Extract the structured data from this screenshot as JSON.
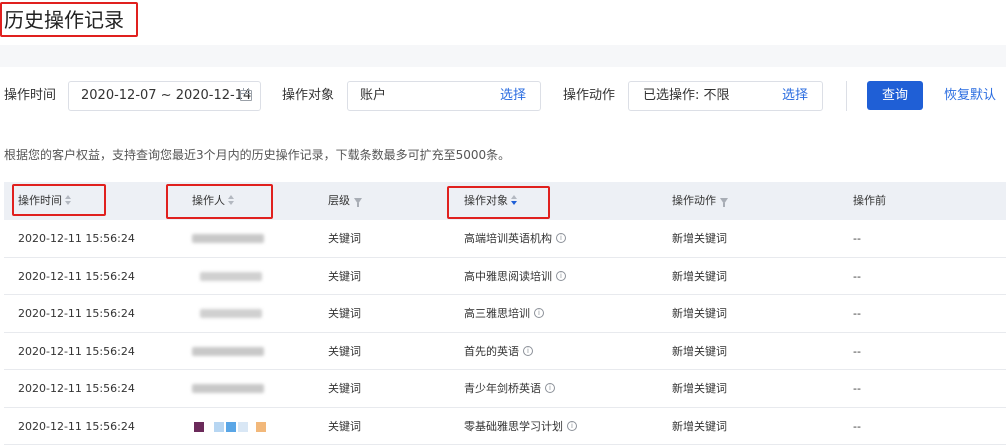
{
  "page_title": "历史操作记录",
  "filters": {
    "time_label": "操作时间",
    "time_value": "2020-12-07 ~ 2020-12-14",
    "object_label": "操作对象",
    "object_value": "账户",
    "object_select": "选择",
    "action_label": "操作动作",
    "action_value": "已选操作: 不限",
    "action_select": "选择",
    "query_button": "查询",
    "reset_link": "恢复默认"
  },
  "notice": "根据您的客户权益，支持查询您最近3个月内的历史操作记录，下载条数最多可扩充至5000条。",
  "table": {
    "headers": [
      "操作时间",
      "操作人",
      "层级",
      "操作对象",
      "操作动作",
      "操作前"
    ],
    "rows": [
      {
        "time": "2020-12-11 15:56:24",
        "level": "关键词",
        "object": "高端培训英语机构",
        "action": "新增关键词",
        "before": "--"
      },
      {
        "time": "2020-12-11 15:56:24",
        "level": "关键词",
        "object": "高中雅思阅读培训",
        "action": "新增关键词",
        "before": "--"
      },
      {
        "time": "2020-12-11 15:56:24",
        "level": "关键词",
        "object": "高三雅思培训",
        "action": "新增关键词",
        "before": "--"
      },
      {
        "time": "2020-12-11 15:56:24",
        "level": "关键词",
        "object": "首先的英语",
        "action": "新增关键词",
        "before": "--"
      },
      {
        "time": "2020-12-11 15:56:24",
        "level": "关键词",
        "object": "青少年剑桥英语",
        "action": "新增关键词",
        "before": "--"
      },
      {
        "time": "2020-12-11 15:56:24",
        "level": "关键词",
        "object": "零基础雅思学习计划",
        "action": "新增关键词",
        "before": "--"
      }
    ]
  },
  "colors": {
    "primary": "#1f5fd6",
    "link": "#2a6ce0",
    "highlight_box": "#e0201e",
    "header_bg": "#edf0f5"
  }
}
